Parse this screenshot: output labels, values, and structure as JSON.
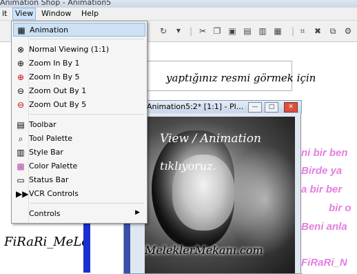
{
  "window": {
    "title": "Animation Shop - Animation5"
  },
  "menubar": {
    "edit_partial": "it",
    "view": "View",
    "window": "Window",
    "help": "Help"
  },
  "toolbar": {
    "icons": [
      "redo-icon",
      "cut-icon",
      "copy-icon",
      "paste-icon",
      "paste-new-icon",
      "paste-before-icon",
      "paste-after-icon",
      "crop-icon",
      "delete-icon",
      "duplicate-icon"
    ]
  },
  "view_menu": {
    "items": [
      {
        "label": "Animation",
        "icon": "animation-icon",
        "highlighted": true
      },
      {
        "label": "Normal Viewing (1:1)",
        "icon": "normal-view-icon"
      },
      {
        "label": "Zoom In By 1",
        "icon": "zoom-in-icon"
      },
      {
        "label": "Zoom In By 5",
        "icon": "zoom-in-5-icon"
      },
      {
        "label": "Zoom Out By 1",
        "icon": "zoom-out-icon"
      },
      {
        "label": "Zoom Out By 5",
        "icon": "zoom-out-5-icon"
      },
      {
        "label": "Toolbar",
        "icon": "toolbar-icon"
      },
      {
        "label": "Tool Palette",
        "icon": "tool-palette-icon"
      },
      {
        "label": "Style Bar",
        "icon": "style-bar-icon"
      },
      {
        "label": "Color Palette",
        "icon": "color-palette-icon"
      },
      {
        "label": "Status Bar",
        "icon": "status-bar-icon"
      },
      {
        "label": "VCR Controls",
        "icon": "vcr-controls-icon"
      },
      {
        "label": "Controls",
        "icon": ""
      }
    ]
  },
  "canvas": {
    "instruction_text": "yaptığınız resmi görmek için",
    "signature_left": "FiRaRi_MeLeK"
  },
  "image_window": {
    "title": "Animation5:2* [1:1] - Pl...",
    "caption_line1": "View / Animation",
    "caption_line2": "tıklıyoruz.",
    "watermark": "MeleklerMekanı.com"
  },
  "pink_panel": {
    "lines": [
      "ni bir ben",
      "Birde ya",
      "a bir ber",
      "bir o",
      "Beni anla",
      "FiRaRi_N"
    ]
  },
  "colors": {
    "pink_text": "#e47ee0",
    "menu_highlight": "#cde1f5",
    "accent_blue": "#1a2fd0"
  }
}
